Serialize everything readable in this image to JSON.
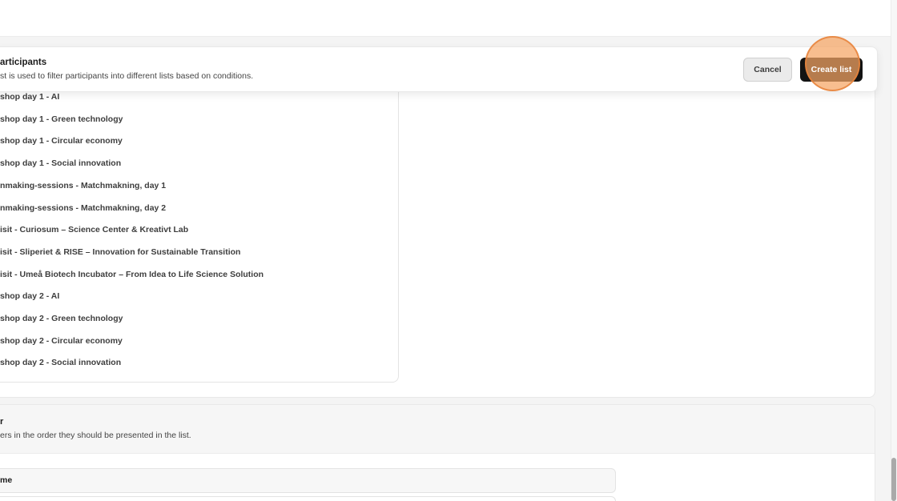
{
  "header": {
    "title": "articipants",
    "description": "st is used to filter participants into different lists based on conditions.",
    "cancel_label": "Cancel",
    "create_label": "Create list"
  },
  "conditions": {
    "items": [
      "shop day 1 - AI",
      "shop day 1 - Green technology",
      "shop day 1 - Circular economy",
      "shop day 1 - Social innovation",
      "nmaking-sessions - Matchmakning, day 1",
      "nmaking-sessions - Matchmakning, day 2",
      "isit - Curiosum – Science Center & Kreativt Lab",
      "isit - Sliperiet & RISE – Innovation for Sustainable Transition",
      "isit - Umeå Biotech Incubator – From Idea to Life Science Solution",
      "shop day 2 - AI",
      "shop day 2 - Green technology",
      "shop day 2 - Circular economy",
      "shop day 2 - Social innovation"
    ]
  },
  "order": {
    "title": "r",
    "description": "ers in the order they should be presented in the list.",
    "first_field": "me"
  },
  "colors": {
    "primary_button": "#131313",
    "click_indicator": "#f5a564",
    "page_background": "#f4f4f4"
  }
}
